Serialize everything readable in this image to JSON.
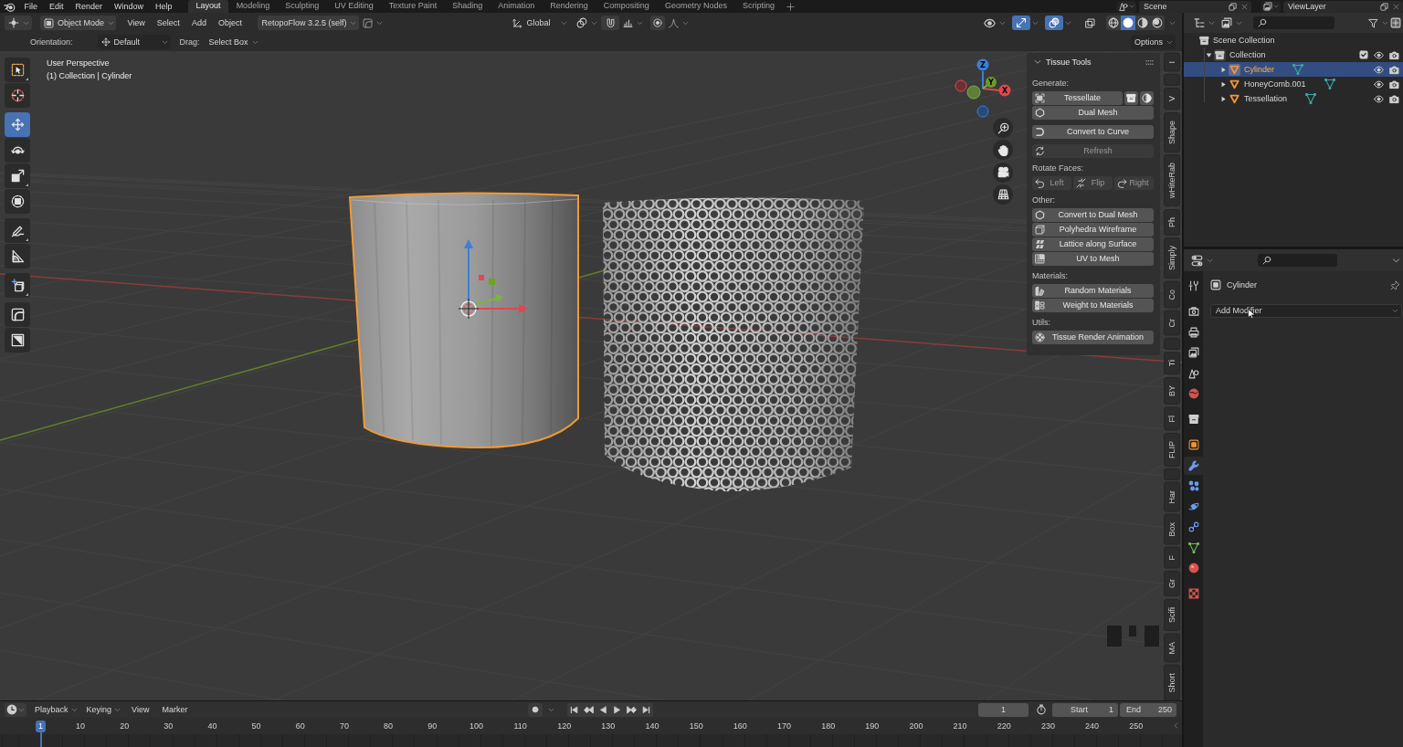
{
  "top_bar": {
    "menus": [
      "File",
      "Edit",
      "Render",
      "Window",
      "Help"
    ],
    "workspaces": [
      {
        "label": "Layout",
        "selected": true
      },
      {
        "label": "Modeling",
        "selected": false
      },
      {
        "label": "Sculpting",
        "selected": false
      },
      {
        "label": "UV Editing",
        "selected": false
      },
      {
        "label": "Texture Paint",
        "selected": false
      },
      {
        "label": "Shading",
        "selected": false
      },
      {
        "label": "Animation",
        "selected": false
      },
      {
        "label": "Rendering",
        "selected": false
      },
      {
        "label": "Compositing",
        "selected": false
      },
      {
        "label": "Geometry Nodes",
        "selected": false
      },
      {
        "label": "Scripting",
        "selected": false
      }
    ],
    "scene": "Scene",
    "view_layer": "ViewLayer"
  },
  "viewport": {
    "header": {
      "mode": "Object Mode",
      "menus": [
        "View",
        "Select",
        "Add",
        "Object"
      ],
      "addon": "RetopoFlow 3.2.5 (self)",
      "orientation": "Global",
      "gizmos": true,
      "overlays": true,
      "shading": [
        {
          "kind": "wireframe",
          "selected": false
        },
        {
          "kind": "solid",
          "selected": true
        },
        {
          "kind": "material",
          "selected": false
        },
        {
          "kind": "rendered",
          "selected": false
        }
      ]
    },
    "tool_settings": {
      "orientation_label": "Orientation:",
      "orientation": "Default",
      "drag_label": "Drag:",
      "drag": "Select Box",
      "options": "Options"
    },
    "toolbar": [
      {
        "tools": [
          {
            "kind": "select-box",
            "selected": false,
            "variants": true
          },
          {
            "kind": "cursor",
            "selected": false,
            "variants": false
          }
        ]
      },
      {
        "tools": [
          {
            "kind": "move",
            "selected": true,
            "variants": false
          },
          {
            "kind": "rotate",
            "selected": false,
            "variants": false
          },
          {
            "kind": "scale",
            "selected": false,
            "variants": true
          },
          {
            "kind": "transform",
            "selected": false,
            "variants": false
          }
        ]
      },
      {
        "tools": [
          {
            "kind": "annotate",
            "selected": false,
            "variants": true
          },
          {
            "kind": "measure",
            "selected": false,
            "variants": false
          }
        ]
      },
      {
        "tools": [
          {
            "kind": "add-cube",
            "selected": false,
            "variants": true
          }
        ]
      },
      {
        "tools": [
          {
            "kind": "corner-tool",
            "selected": false,
            "variants": false
          },
          {
            "kind": "diagonal-tool",
            "selected": false,
            "variants": false
          }
        ]
      }
    ],
    "info": [
      "User Perspective",
      "(1) Collection | Cylinder"
    ],
    "navigation_gizmo": {
      "x": "X",
      "y": "Y",
      "z": "Z"
    },
    "tissue_panel": {
      "title": "Tissue Tools",
      "expanded": true,
      "sections": [
        {
          "label": "Generate:",
          "groups": [
            {
              "kind": "column",
              "buttons": [
                {
                  "kind": "tessellate",
                  "label": "Tessellate",
                  "disabled": false,
                  "extras": [
                    {
                      "kind": "archive"
                    },
                    {
                      "kind": "shading"
                    }
                  ]
                },
                {
                  "kind": "dual-mesh",
                  "label": "Dual Mesh",
                  "disabled": false
                }
              ]
            },
            {
              "kind": "column",
              "buttons": [
                {
                  "kind": "convert-to-curve",
                  "label": "Convert to Curve",
                  "disabled": false
                }
              ]
            },
            {
              "kind": "column",
              "buttons": [
                {
                  "kind": "refresh",
                  "label": "Refresh",
                  "disabled": true
                }
              ]
            }
          ]
        },
        {
          "label": "Rotate Faces:",
          "groups": [
            {
              "kind": "row",
              "buttons": [
                {
                  "kind": "rotate-left",
                  "label": "Left",
                  "disabled": true
                },
                {
                  "kind": "flip",
                  "label": "Flip",
                  "disabled": true
                },
                {
                  "kind": "rotate-right",
                  "label": "Right",
                  "disabled": true
                }
              ]
            }
          ]
        },
        {
          "label": "Other:",
          "groups": [
            {
              "kind": "column",
              "buttons": [
                {
                  "kind": "convert-to-dual-mesh",
                  "label": "Convert to Dual Mesh",
                  "disabled": false
                },
                {
                  "kind": "polyhedra-wireframe",
                  "label": "Polyhedra Wireframe",
                  "disabled": false
                },
                {
                  "kind": "lattice-along-surface",
                  "label": "Lattice along Surface",
                  "disabled": false
                },
                {
                  "kind": "uv-to-mesh",
                  "label": "UV to Mesh",
                  "disabled": false
                }
              ]
            }
          ]
        },
        {
          "label": "Materials:",
          "groups": [
            {
              "kind": "column",
              "buttons": [
                {
                  "kind": "random-materials",
                  "label": "Random Materials",
                  "disabled": false
                },
                {
                  "kind": "weight-to-materials",
                  "label": "Weight to Materials",
                  "disabled": false
                }
              ]
            }
          ]
        },
        {
          "label": "Utils:",
          "groups": [
            {
              "kind": "column",
              "buttons": [
                {
                  "kind": "render-animation",
                  "label": "Tissue Render Animation",
                  "disabled": false
                }
              ]
            }
          ]
        }
      ]
    },
    "sidebar_tabs": [
      {
        "kind": "label",
        "label": "I"
      },
      {
        "kind": "blank"
      },
      {
        "kind": "label",
        "label": "V"
      },
      {
        "kind": "label",
        "label": "Shape"
      },
      {
        "kind": "label",
        "label": "wHiteRab"
      },
      {
        "kind": "label",
        "label": "Ph"
      },
      {
        "kind": "label",
        "label": "Simply"
      },
      {
        "kind": "label",
        "label": "Co"
      },
      {
        "kind": "label",
        "label": "Cr"
      },
      {
        "kind": "blank"
      },
      {
        "kind": "label",
        "label": "Ti"
      },
      {
        "kind": "label",
        "label": "BY"
      },
      {
        "kind": "label",
        "label": "Fl"
      },
      {
        "kind": "label",
        "label": "FLIP"
      },
      {
        "kind": "blank"
      },
      {
        "kind": "label",
        "label": "Har"
      },
      {
        "kind": "label",
        "label": "Box"
      },
      {
        "kind": "label",
        "label": "F"
      },
      {
        "kind": "label",
        "label": "Gr"
      },
      {
        "kind": "label",
        "label": "Scifi"
      },
      {
        "kind": "label",
        "label": "MA"
      },
      {
        "kind": "label",
        "label": "Short"
      }
    ]
  },
  "outliner": {
    "tree": [
      {
        "label": "Scene Collection",
        "kind": "scene-collection",
        "selected": false,
        "children": [
          {
            "label": "Collection",
            "kind": "collection",
            "selected": false,
            "expanded": true,
            "checked": true,
            "children": [
              {
                "label": "Cylinder",
                "kind": "mesh",
                "selected": true,
                "expanded": false
              },
              {
                "label": "HoneyComb.001",
                "kind": "mesh",
                "selected": false,
                "expanded": false
              },
              {
                "label": "Tessellation",
                "kind": "mesh",
                "selected": false,
                "expanded": false
              }
            ]
          }
        ]
      }
    ]
  },
  "properties": {
    "tab_groups": [
      {
        "tabs": [
          {
            "kind": "tool",
            "selected": false
          }
        ]
      },
      {
        "tabs": [
          {
            "kind": "render",
            "selected": false
          },
          {
            "kind": "output",
            "selected": false
          },
          {
            "kind": "view-layer",
            "selected": false
          },
          {
            "kind": "scene",
            "selected": false
          },
          {
            "kind": "world",
            "selected": false
          }
        ]
      },
      {
        "tabs": [
          {
            "kind": "collection",
            "selected": false
          }
        ]
      },
      {
        "tabs": [
          {
            "kind": "object",
            "selected": false
          },
          {
            "kind": "modifiers",
            "selected": true
          },
          {
            "kind": "particles",
            "selected": false
          },
          {
            "kind": "physics",
            "selected": false
          },
          {
            "kind": "constraints",
            "selected": false
          },
          {
            "kind": "data",
            "selected": false
          },
          {
            "kind": "material",
            "selected": false
          }
        ]
      },
      {
        "tabs": [
          {
            "kind": "texture",
            "selected": false
          }
        ]
      }
    ],
    "object_name": "Cylinder",
    "add_modifier": "Add Modifier"
  },
  "timeline": {
    "menus": [
      {
        "label": "Playback",
        "kind": "dropdown"
      },
      {
        "label": "Keying",
        "kind": "dropdown"
      },
      {
        "label": "View",
        "kind": "menu"
      },
      {
        "label": "Marker",
        "kind": "menu"
      }
    ],
    "current_frame": "1",
    "start_label": "Start",
    "start": "1",
    "end_label": "End",
    "end": "250",
    "frames": [
      {
        "label": "1",
        "selected": true
      },
      {
        "label": "10",
        "selected": false
      },
      {
        "label": "20",
        "selected": false
      },
      {
        "label": "30",
        "selected": false
      },
      {
        "label": "40",
        "selected": false
      },
      {
        "label": "50",
        "selected": false
      },
      {
        "label": "60",
        "selected": false
      },
      {
        "label": "70",
        "selected": false
      },
      {
        "label": "80",
        "selected": false
      },
      {
        "label": "90",
        "selected": false
      },
      {
        "label": "100",
        "selected": false
      },
      {
        "label": "110",
        "selected": false
      },
      {
        "label": "120",
        "selected": false
      },
      {
        "label": "130",
        "selected": false
      },
      {
        "label": "140",
        "selected": false
      },
      {
        "label": "150",
        "selected": false
      },
      {
        "label": "160",
        "selected": false
      },
      {
        "label": "170",
        "selected": false
      },
      {
        "label": "180",
        "selected": false
      },
      {
        "label": "190",
        "selected": false
      },
      {
        "label": "200",
        "selected": false
      },
      {
        "label": "210",
        "selected": false
      },
      {
        "label": "220",
        "selected": false
      },
      {
        "label": "230",
        "selected": false
      },
      {
        "label": "240",
        "selected": false
      },
      {
        "label": "250",
        "selected": false
      }
    ]
  }
}
